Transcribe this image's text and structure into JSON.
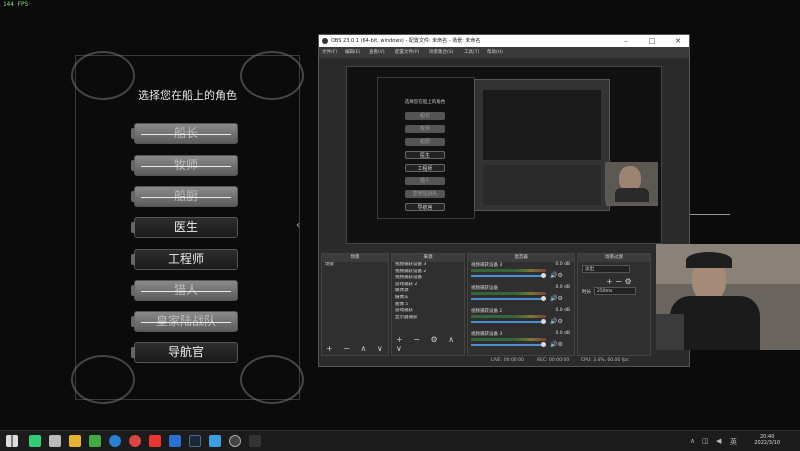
{
  "fps": "144 FPS",
  "game": {
    "title": "选择您在船上的角色",
    "roles": [
      {
        "label": "船长",
        "available": false
      },
      {
        "label": "牧师",
        "available": false
      },
      {
        "label": "船厨",
        "available": false
      },
      {
        "label": "医生",
        "available": true
      },
      {
        "label": "工程师",
        "available": true
      },
      {
        "label": "猎人",
        "available": false
      },
      {
        "label": "皇家陆战队",
        "available": false
      },
      {
        "label": "导航官",
        "available": true
      }
    ]
  },
  "obs": {
    "title": "OBS 23.0.1 (64-bit, windows) - 配置文件: 未命名 - 场景: 未命名",
    "menu": [
      "文件(F)",
      "编辑(E)",
      "查看(V)",
      "配置文件(P)",
      "场景集合(S)",
      "工具(T)",
      "帮助(H)"
    ],
    "docks": {
      "scenes": {
        "header": "场景",
        "items": [
          "场景"
        ]
      },
      "sources": {
        "header": "来源",
        "items": [
          "视频捕获设备 3",
          "视频捕获设备 2",
          "视频捕获设备",
          "游戏捕获 2",
          "媒体源",
          "摄像头",
          "图像 5",
          "游戏捕获",
          "显示器捕获"
        ]
      },
      "mixer": {
        "header": "混音器",
        "channels": [
          {
            "name": "视频捕获设备 3",
            "db": "0.0 dB"
          },
          {
            "name": "视频捕获设备",
            "db": "0.0 dB"
          },
          {
            "name": "视频捕获设备 2",
            "db": "0.0 dB"
          },
          {
            "name": "视频捕获设备 3",
            "db": "0.0 dB"
          }
        ]
      },
      "transitions": {
        "header": "场景过渡",
        "type": "淡出",
        "duration_label": "时长",
        "duration_value": "250ms"
      }
    },
    "status": {
      "live": "LIVE: 00:00:00",
      "rec": "REC: 00:00:00",
      "cpu": "CPU: 3.4%, 60.00 fps"
    }
  },
  "taskbar": {
    "time": "20:40",
    "date": "2022/3/10",
    "icons": [
      "start-icon",
      "search-icon",
      "task-view-icon",
      "folder-icon",
      "store-icon",
      "edge-icon",
      "chrome-icon",
      "weibo-icon",
      "shield-icon",
      "steam-icon",
      "qq-icon",
      "obs-icon",
      "app-icon"
    ]
  },
  "colors": {
    "accent": "#4a8fd6",
    "disabled_role": "#7a7a7a",
    "active_role": "#222222"
  }
}
